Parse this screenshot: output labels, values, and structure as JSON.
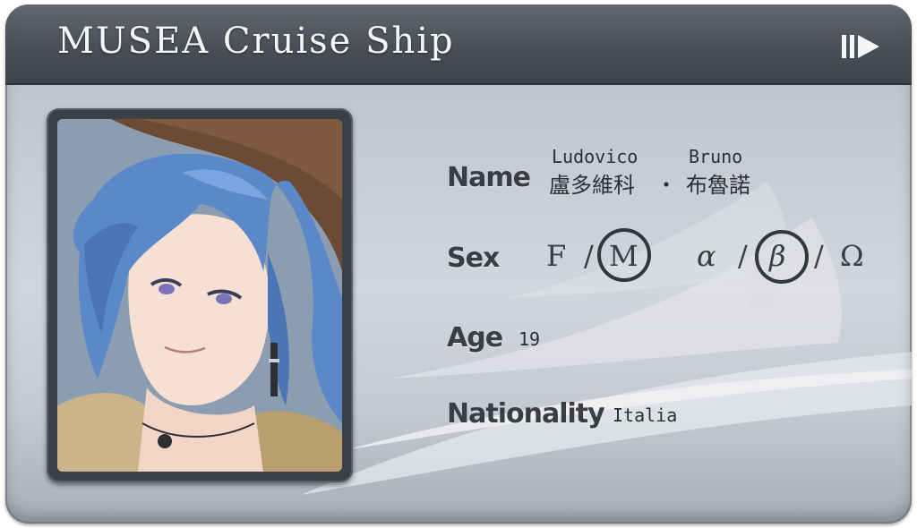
{
  "header": {
    "title": "MUSEA Cruise Ship",
    "skip_icon": "skip-forward-icon"
  },
  "profile": {
    "name_label": "Name",
    "given_name_roman": "Ludovico",
    "family_name_roman": "Bruno",
    "given_name_cjk": "盧多維科",
    "name_separator": "・",
    "family_name_cjk": "布魯諾",
    "sex_label": "Sex",
    "sex_options": [
      "F",
      "/",
      "M",
      "α",
      "/",
      "β",
      "/",
      "Ω"
    ],
    "selected_sex": "M",
    "selected_dynamic": "β",
    "age_label": "Age",
    "age_value": "19",
    "nationality_label": "Nationality",
    "nationality_value": "Italia"
  },
  "colors": {
    "header_bg": "#4a4e56",
    "card_bg": "#c7cad3",
    "label_text": "#3a3d44",
    "circle_stroke": "#33363c"
  }
}
